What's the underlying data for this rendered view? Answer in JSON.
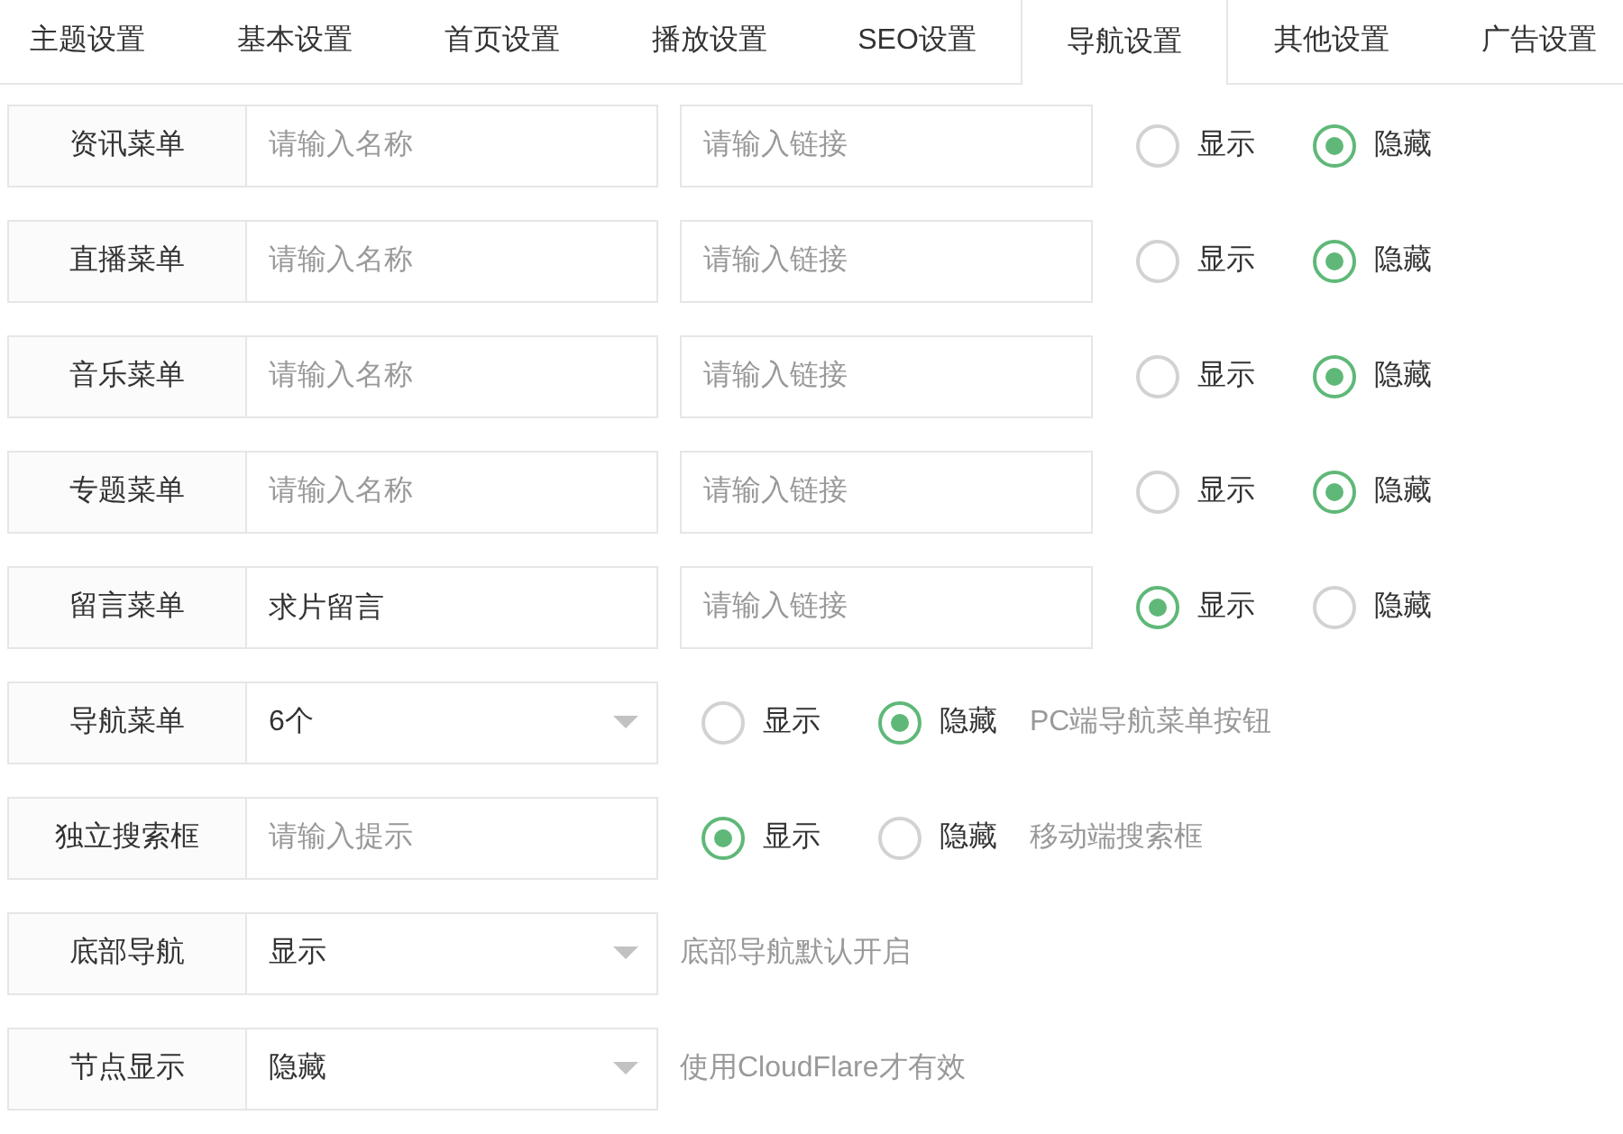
{
  "tabs": [
    {
      "label": "主题设置",
      "selected": false
    },
    {
      "label": "基本设置",
      "selected": false
    },
    {
      "label": "首页设置",
      "selected": false
    },
    {
      "label": "播放设置",
      "selected": false
    },
    {
      "label": "SEO设置",
      "selected": false
    },
    {
      "label": "导航设置",
      "selected": true
    },
    {
      "label": "其他设置",
      "selected": false
    },
    {
      "label": "广告设置",
      "selected": false
    }
  ],
  "rows": [
    {
      "kind": "menu",
      "label": "资讯菜单",
      "name_field": {
        "placeholder": "请输入名称"
      },
      "link_field": {
        "placeholder": "请输入链接"
      },
      "options": [
        {
          "label": "显示",
          "selected": false
        },
        {
          "label": "隐藏",
          "selected": true
        }
      ]
    },
    {
      "kind": "menu",
      "label": "直播菜单",
      "name_field": {
        "placeholder": "请输入名称"
      },
      "link_field": {
        "placeholder": "请输入链接"
      },
      "options": [
        {
          "label": "显示",
          "selected": false
        },
        {
          "label": "隐藏",
          "selected": true
        }
      ]
    },
    {
      "kind": "menu",
      "label": "音乐菜单",
      "name_field": {
        "placeholder": "请输入名称"
      },
      "link_field": {
        "placeholder": "请输入链接"
      },
      "options": [
        {
          "label": "显示",
          "selected": false
        },
        {
          "label": "隐藏",
          "selected": true
        }
      ]
    },
    {
      "kind": "menu",
      "label": "专题菜单",
      "name_field": {
        "placeholder": "请输入名称"
      },
      "link_field": {
        "placeholder": "请输入链接"
      },
      "options": [
        {
          "label": "显示",
          "selected": false
        },
        {
          "label": "隐藏",
          "selected": true
        }
      ]
    },
    {
      "kind": "menu",
      "label": "留言菜单",
      "name_field": {
        "value": "求片留言"
      },
      "link_field": {
        "placeholder": "请输入链接"
      },
      "options": [
        {
          "label": "显示",
          "selected": true
        },
        {
          "label": "隐藏",
          "selected": false
        }
      ]
    },
    {
      "kind": "select",
      "label": "导航菜单",
      "select": {
        "value": "6个"
      },
      "options": [
        {
          "label": "显示",
          "selected": false
        },
        {
          "label": "隐藏",
          "selected": true
        }
      ],
      "hint": "PC端导航菜单按钮"
    },
    {
      "kind": "input",
      "label": "独立搜索框",
      "input": {
        "placeholder": "请输入提示"
      },
      "options": [
        {
          "label": "显示",
          "selected": true
        },
        {
          "label": "隐藏",
          "selected": false
        }
      ],
      "hint": "移动端搜索框"
    },
    {
      "kind": "select",
      "label": "底部导航",
      "select": {
        "value": "显示"
      },
      "hint": "底部导航默认开启"
    },
    {
      "kind": "select",
      "label": "节点显示",
      "select": {
        "value": "隐藏"
      },
      "hint": "使用CloudFlare才有效"
    }
  ]
}
